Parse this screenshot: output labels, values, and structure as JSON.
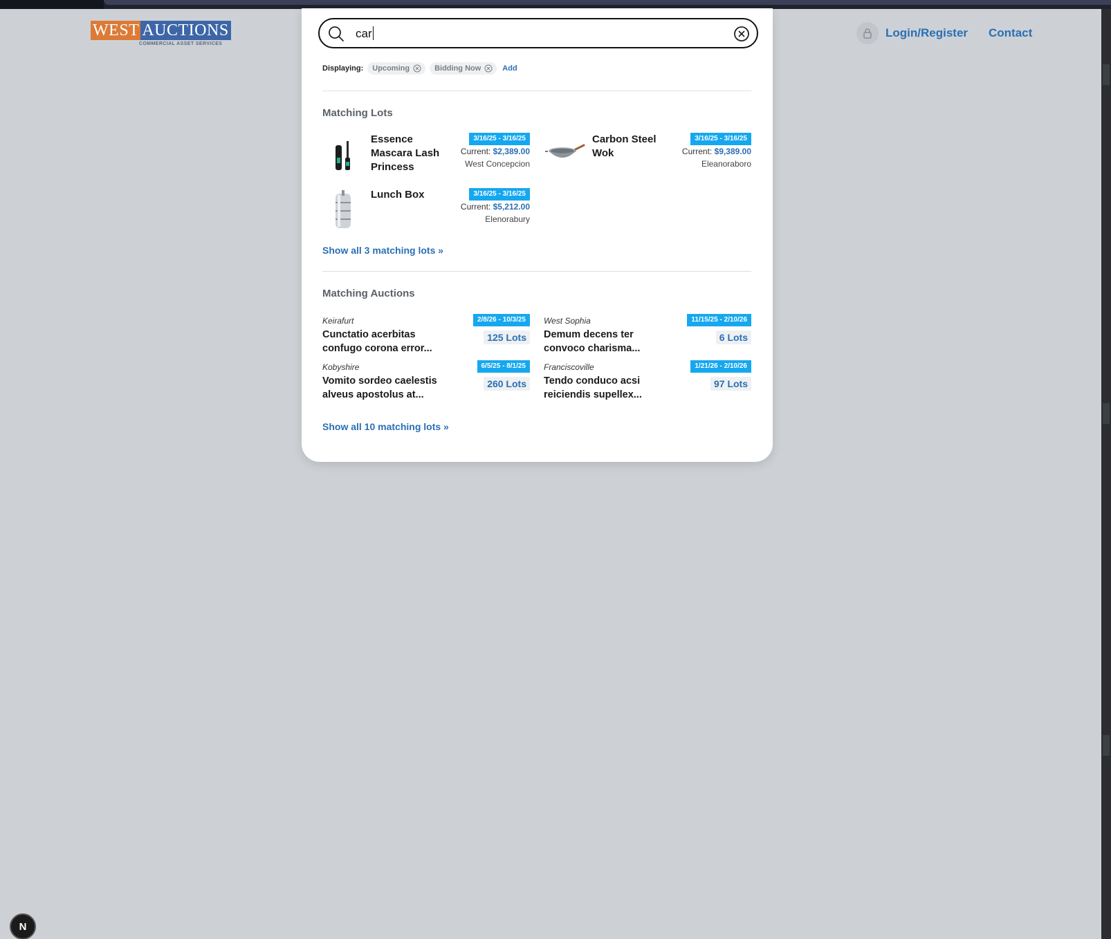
{
  "header": {
    "logo": {
      "word1": "WEST",
      "word2": "AUCTIONS",
      "tagline": "COMMERCIAL ASSET SERVICES"
    },
    "login_label": "Login/Register",
    "contact_label": "Contact",
    "icons": {
      "lock": "lock-icon"
    }
  },
  "search": {
    "value": "car",
    "icons": {
      "search": "search-icon",
      "clear": "clear-circle-icon"
    }
  },
  "filters": {
    "label": "Displaying:",
    "chips": [
      {
        "label": "Upcoming"
      },
      {
        "label": "Bidding Now"
      }
    ],
    "add_label": "Add"
  },
  "matching_lots": {
    "title": "Matching Lots",
    "items": [
      {
        "name": "Essence Mascara Lash Princess",
        "dates": "3/16/25 - 3/16/25",
        "current_label": "Current:",
        "current": "$2,389.00",
        "location": "West Concepcion",
        "thumb": "mascara"
      },
      {
        "name": "Carbon Steel Wok",
        "dates": "3/16/25 - 3/16/25",
        "current_label": "Current:",
        "current": "$9,389.00",
        "location": "Eleanoraboro",
        "thumb": "wok"
      },
      {
        "name": "Lunch Box",
        "dates": "3/16/25 - 3/16/25",
        "current_label": "Current:",
        "current": "$5,212.00",
        "location": "Elenorabury",
        "thumb": "lunchbox"
      }
    ],
    "show_all": "Show all 3 matching lots »"
  },
  "matching_auctions": {
    "title": "Matching Auctions",
    "items": [
      {
        "city": "Keirafurt",
        "title": "Cunctatio acerbitas confugo corona error...",
        "dates": "2/8/26 - 10/3/25",
        "lots": "125 Lots"
      },
      {
        "city": "West Sophia",
        "title": "Demum decens ter convoco charisma...",
        "dates": "11/15/25 - 2/10/26",
        "lots": "6 Lots"
      },
      {
        "city": "Kobyshire",
        "title": "Vomito sordeo caelestis alveus apostolus at...",
        "dates": "6/5/25 - 8/1/25",
        "lots": "260 Lots"
      },
      {
        "city": "Franciscoville",
        "title": "Tendo conduco acsi reiciendis supellex...",
        "dates": "1/21/26 - 2/10/26",
        "lots": "97 Lots"
      }
    ],
    "show_all": "Show all 10 matching lots »"
  },
  "corner_badge": "N",
  "colors": {
    "accent": "#2a6fb5",
    "badge": "#16a8ef",
    "background": "#cdd1d5",
    "logo_orange": "#dc7a36",
    "logo_blue": "#3d66a8"
  }
}
